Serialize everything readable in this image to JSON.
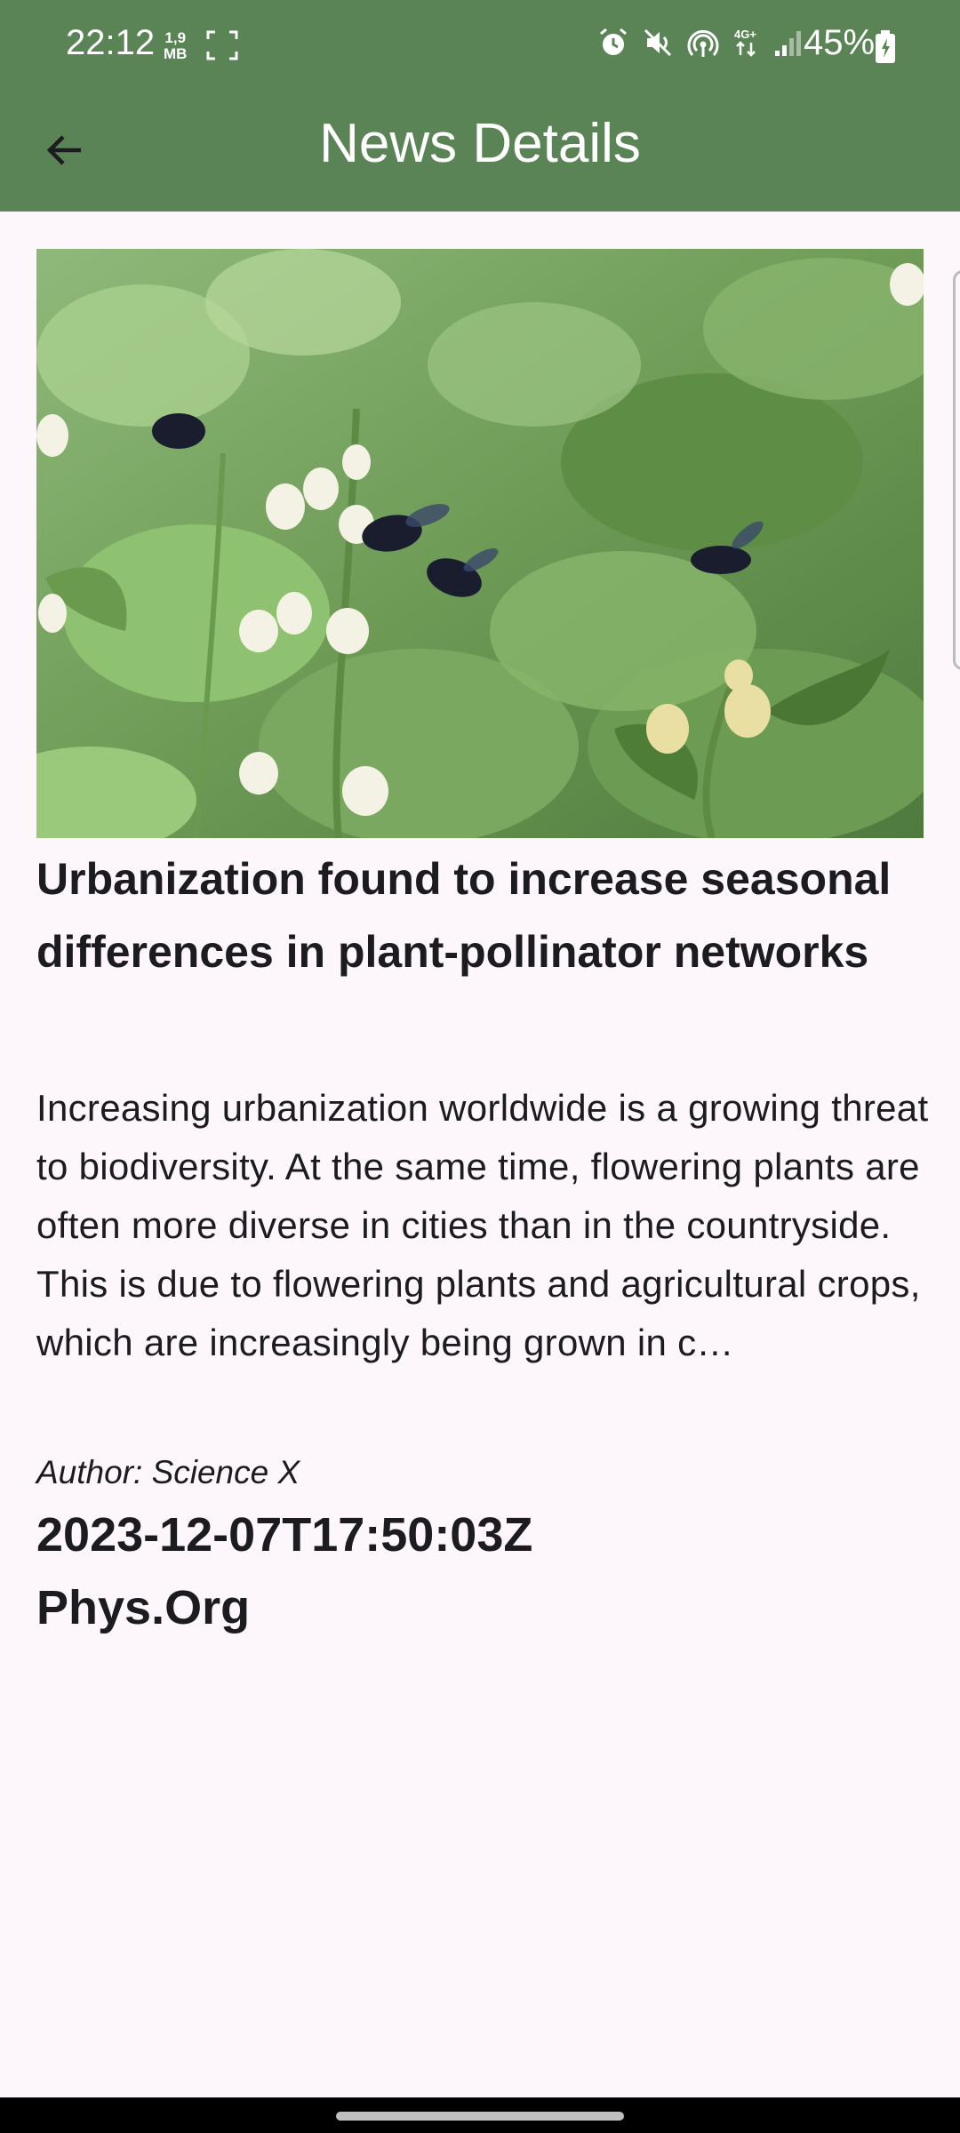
{
  "status_bar": {
    "time": "22:12",
    "speed_top": "1,9",
    "speed_bottom": "MB",
    "battery": "45%",
    "icons": [
      "screenshot-icon",
      "alarm-icon",
      "mute-icon",
      "hotspot-icon",
      "4g-icon",
      "signal-icon",
      "battery-icon"
    ]
  },
  "app_bar": {
    "title": "News Details",
    "back_icon": "arrow-back-icon",
    "background": "#5b8456"
  },
  "article": {
    "image_alt": "Bees pollinating white flowers on bean plants",
    "title": "Urbanization found to increase seasonal differences in plant-pollinator networks",
    "description": "Increasing urbanization worldwide is a growing threat to biodiversity. At the same time, flowering plants are often more diverse in cities than in the countryside. This is due to flowering plants and agricultural crops, which are increasingly being grown in c…",
    "author": "Author: Science X",
    "published_at": "2023-12-07T17:50:03Z",
    "source": "Phys.Org"
  }
}
